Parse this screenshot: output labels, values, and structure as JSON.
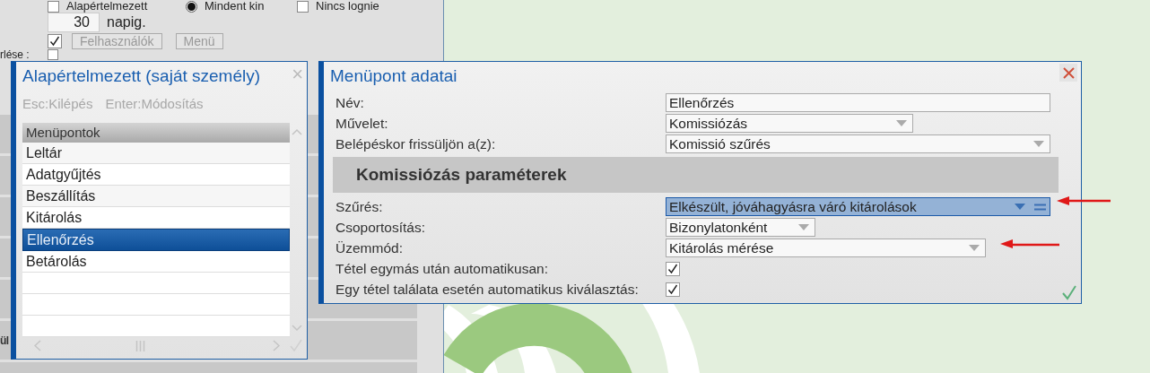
{
  "background_form": {
    "options": [
      {
        "kind": "checkbox",
        "label": "Alapértelmezett",
        "checked": false
      },
      {
        "kind": "radio",
        "label": "Mindent kin",
        "selected": true
      },
      {
        "kind": "checkbox",
        "label": "Nincs lognie",
        "checked": false
      }
    ],
    "days_value": "30",
    "days_unit": "napig.",
    "users_checked": true,
    "buttons": [
      {
        "label": "Felhasználók",
        "disabled": true
      },
      {
        "label": "Menü",
        "disabled": true
      }
    ],
    "cut_label": "rlése :",
    "cut_checked": false,
    "row_label": "ül"
  },
  "list_dialog": {
    "title": "Alapértelmezett (saját személy)",
    "close": "×",
    "hints": [
      {
        "key": "Esc:",
        "action": "Kilépés"
      },
      {
        "key": "Enter:",
        "action": "Módosítás"
      }
    ],
    "column": "Menüpontok",
    "items": [
      {
        "label": "Leltár",
        "selected": false
      },
      {
        "label": "Adatgyűjtés",
        "selected": false
      },
      {
        "label": "Beszállítás",
        "selected": false
      },
      {
        "label": "Kitárolás",
        "selected": false
      },
      {
        "label": "Ellenőrzés",
        "selected": true
      },
      {
        "label": "Betárolás",
        "selected": false
      }
    ]
  },
  "detail_dialog": {
    "title": "Menüpont adatai",
    "fields": [
      {
        "kind": "text",
        "label": "Név:",
        "value": "Ellenőrzés"
      },
      {
        "kind": "dropdown",
        "label": "Művelet:",
        "value": "Komissiózás",
        "selected": false
      },
      {
        "kind": "dropdown",
        "label": "Belépéskor frissüljön a(z):",
        "value": "Komissió szűrés",
        "selected": false
      }
    ],
    "section": "Komissiózás paraméterek",
    "params": [
      {
        "kind": "dropdown",
        "label": "Szűrés:",
        "value": "Elkészült, jóváhagyásra váró kitárolások",
        "selected": true
      },
      {
        "kind": "dropdown",
        "label": "Csoportosítás:",
        "value": "Bizonylatonként",
        "selected": false
      },
      {
        "kind": "dropdown",
        "label": "Üzemmód:",
        "value": "Kitárolás mérése",
        "selected": false
      },
      {
        "kind": "checkbox",
        "label": "Tétel egymás után automatikusan:",
        "checked": true
      },
      {
        "kind": "checkbox",
        "label": "Egy tétel találata esetén automatikus kiválasztás:",
        "checked": true
      }
    ]
  }
}
